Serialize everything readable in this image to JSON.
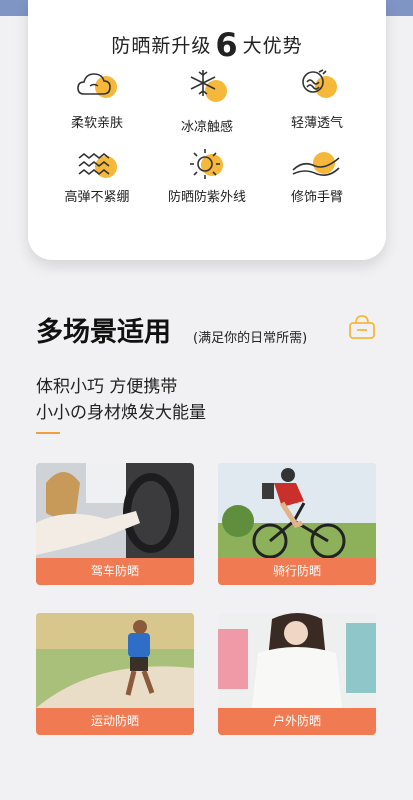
{
  "card": {
    "title_pre": "防晒新升级",
    "title_num": "6",
    "title_post": "大优势",
    "features": [
      {
        "label": "柔软亲肤",
        "icon": "cloud-icon"
      },
      {
        "label": "冰凉触感",
        "icon": "snowflake-icon"
      },
      {
        "label": "轻薄透气",
        "icon": "breeze-icon"
      },
      {
        "label": "高弹不紧绷",
        "icon": "wave-icon"
      },
      {
        "label": "防晒防紫外线",
        "icon": "sun-icon"
      },
      {
        "label": "修饰手臂",
        "icon": "arm-icon"
      }
    ]
  },
  "section": {
    "title": "多场景适用",
    "subtitle": "(满足你的日常所需)",
    "line1": "体积小巧 方便携带",
    "line2": "小小の身材焕发大能量"
  },
  "scenes": [
    {
      "label": "驾车防晒"
    },
    {
      "label": "骑行防晒"
    },
    {
      "label": "运动防晒"
    },
    {
      "label": "户外防晒"
    }
  ],
  "colors": {
    "accent": "#f6b83a",
    "banner": "#f07a52",
    "top_band": "#7f95c4"
  }
}
